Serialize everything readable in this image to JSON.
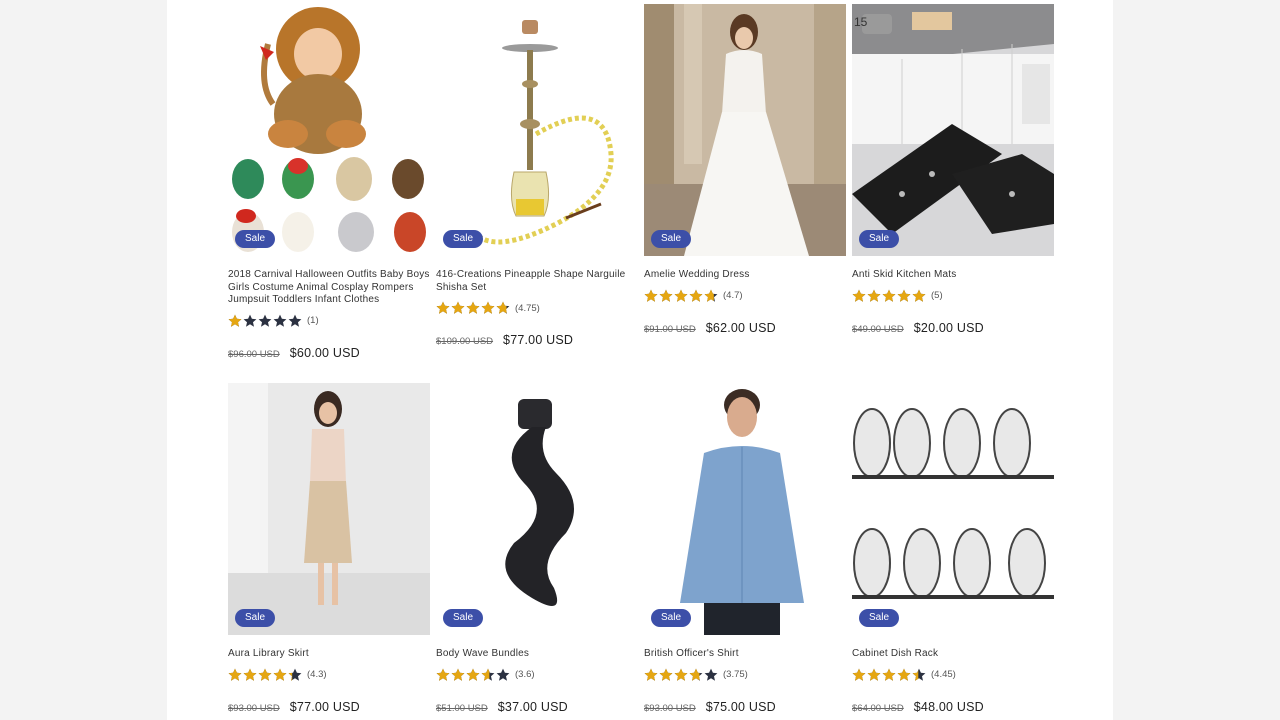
{
  "colors": {
    "sale_badge": "#3c4fa8",
    "star_filled": "#e5a612",
    "star_empty": "#2b3141"
  },
  "products": [
    {
      "title": "2018 Carnival Halloween Outfits Baby Boys Girls Costume Animal Cosplay Rompers Jumpsuit Toddlers Infant Clothes",
      "badge": "Sale",
      "rating": 1,
      "rating_text": "(1)",
      "old_price": "$96.00 USD",
      "price": "$60.00 USD",
      "image": "lion-costume-baby"
    },
    {
      "title": "416-Creations Pineapple Shape Narguile Shisha Set",
      "badge": "Sale",
      "rating": 4.75,
      "rating_text": "(4.75)",
      "old_price": "$109.00 USD",
      "price": "$77.00 USD",
      "image": "hookah"
    },
    {
      "title": "Amelie Wedding Dress",
      "badge": "Sale",
      "rating": 4.7,
      "rating_text": "(4.7)",
      "old_price": "$91.00 USD",
      "price": "$62.00 USD",
      "image": "wedding-dress"
    },
    {
      "title": "Anti Skid Kitchen Mats",
      "badge": "Sale",
      "rating": 5,
      "rating_text": "(5)",
      "old_price": "$49.00 USD",
      "price": "$20.00 USD",
      "image": "kitchen-mats"
    },
    {
      "title": "Aura Library Skirt",
      "badge": "Sale",
      "rating": 4.3,
      "rating_text": "(4.3)",
      "old_price": "$93.00 USD",
      "price": "$77.00 USD",
      "image": "skirt-model"
    },
    {
      "title": "Body Wave Bundles",
      "badge": "Sale",
      "rating": 3.6,
      "rating_text": "(3.6)",
      "old_price": "$51.00 USD",
      "price": "$37.00 USD",
      "image": "hair-bundle"
    },
    {
      "title": "British Officer's Shirt",
      "badge": "Sale",
      "rating": 3.75,
      "rating_text": "(3.75)",
      "old_price": "$93.00 USD",
      "price": "$75.00 USD",
      "image": "blue-shirt-man"
    },
    {
      "title": "Cabinet Dish Rack",
      "badge": "Sale",
      "rating": 4.45,
      "rating_text": "(4.45)",
      "old_price": "$64.00 USD",
      "price": "$48.00 USD",
      "image": "dish-rack"
    }
  ]
}
